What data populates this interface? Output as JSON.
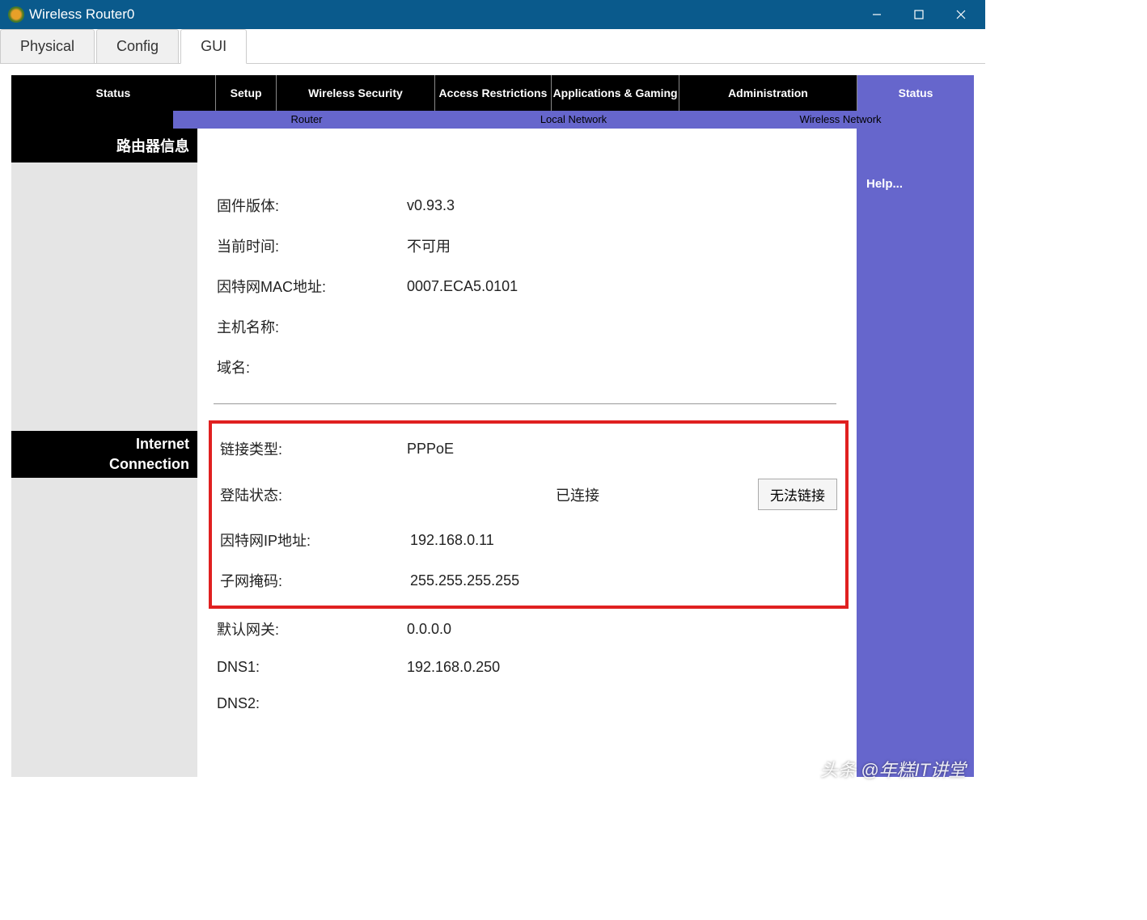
{
  "window": {
    "title": "Wireless Router0"
  },
  "tabs": {
    "physical": "Physical",
    "config": "Config",
    "gui": "GUI"
  },
  "nav": {
    "status_title": "Status",
    "setup": "Setup",
    "wireless_security": "Wireless Security",
    "access_restrictions": "Access Restrictions",
    "applications_gaming": "Applications & Gaming",
    "administration": "Administration",
    "status": "Status"
  },
  "subnav": {
    "router": "Router",
    "local_network": "Local Network",
    "wireless_network": "Wireless Network"
  },
  "sections": {
    "router_info": "路由器信息",
    "internet_connection_line1": "Internet",
    "internet_connection_line2": "Connection"
  },
  "router_info": {
    "firmware_label": "固件版体:",
    "firmware_value": "v0.93.3",
    "current_time_label": "当前时间:",
    "current_time_value": "不可用",
    "internet_mac_label": "因特网MAC地址:",
    "internet_mac_value": "0007.ECA5.0101",
    "host_name_label": "主机名称:",
    "host_name_value": "",
    "domain_name_label": "域名:",
    "domain_name_value": ""
  },
  "internet_conn": {
    "conn_type_label": "链接类型:",
    "conn_type_value": "PPPoE",
    "login_status_label": "登陆状态:",
    "login_status_value": "已连接",
    "disconnect_btn": "无法链接",
    "internet_ip_label": "因特网IP地址:",
    "internet_ip_value": "192.168.0.11",
    "subnet_mask_label": "子网掩码:",
    "subnet_mask_value": "255.255.255.255",
    "default_gateway_label": "默认网关:",
    "default_gateway_value": "0.0.0.0",
    "dns1_label": "DNS1:",
    "dns1_value": "192.168.0.250",
    "dns2_label": "DNS2:",
    "dns2_value": ""
  },
  "help": {
    "link": "Help..."
  },
  "watermark": "头条 @年糕IT讲堂"
}
